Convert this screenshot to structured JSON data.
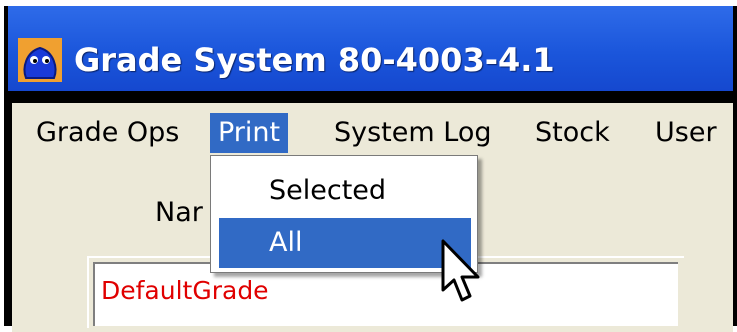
{
  "window": {
    "title": "Grade System 80-4003-4.1",
    "icon": "app-blob-icon"
  },
  "menubar": {
    "items": [
      {
        "label": "Grade Ops",
        "active": false
      },
      {
        "label": "Print",
        "active": true
      },
      {
        "label": "System Log",
        "active": false
      },
      {
        "label": "Stock",
        "active": false
      },
      {
        "label": "User",
        "active": false
      }
    ]
  },
  "print_menu": {
    "items": [
      {
        "label": "Selected",
        "highlighted": false
      },
      {
        "label": "All",
        "highlighted": true
      }
    ]
  },
  "form": {
    "name_label": "Nar"
  },
  "grade_list": {
    "items": [
      "DefaultGrade"
    ]
  },
  "colors": {
    "titlebar": "#1b56db",
    "menu_highlight": "#316ac5",
    "list_text": "#e00000",
    "window_bg": "#ece9d8"
  }
}
